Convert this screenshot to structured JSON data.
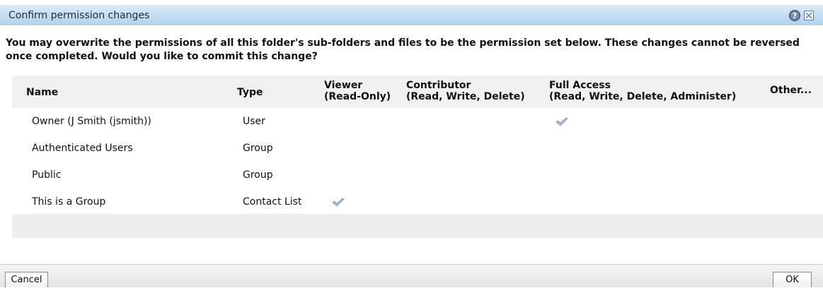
{
  "dialog": {
    "title": "Confirm permission changes",
    "message": "You may overwrite the permissions of all this folder's sub-folders and files to be the permission set below. These changes cannot be reversed once completed. Would you like to commit this change?"
  },
  "table": {
    "headers": {
      "name": "Name",
      "type": "Type",
      "viewer_line1": "Viewer",
      "viewer_line2": "(Read-Only)",
      "contributor_line1": "Contributor",
      "contributor_line2": "(Read, Write, Delete)",
      "full_line1": "Full Access",
      "full_line2": "(Read, Write, Delete, Administer)",
      "other": "Other..."
    },
    "rows": [
      {
        "name": "Owner (J Smith (jsmith))",
        "type": "User",
        "permission": "full_access"
      },
      {
        "name": "Authenticated Users",
        "type": "Group",
        "permission": ""
      },
      {
        "name": "Public",
        "type": "Group",
        "permission": ""
      },
      {
        "name": "This is a Group",
        "type": "Contact List",
        "permission": "viewer"
      }
    ]
  },
  "buttons": {
    "cancel": "Cancel",
    "ok": "OK"
  },
  "icons": {
    "help": "help-icon",
    "close": "close-icon",
    "check": "checkmark-icon"
  },
  "colors": {
    "titlebar": "#c2dcf0",
    "checkmark": "#9fb4d4"
  }
}
